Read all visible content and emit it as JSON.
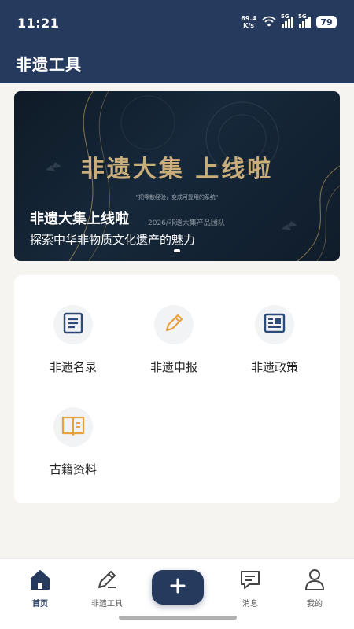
{
  "status_bar": {
    "time": "11:21",
    "net_speed_value": "69.4",
    "net_speed_unit": "K/s",
    "sim1_label": "5G",
    "sim2_label": "5G",
    "battery": "79"
  },
  "header": {
    "title": "非遗工具"
  },
  "banner": {
    "headline": "非遗大集 上线啦",
    "tagline": "\"把零散经验，变成可复用的系统\"",
    "team": "2026/非遗大集产品团队",
    "title": "非遗大集上线啦",
    "description": "探索中华非物质文化遗产的魅力",
    "carousel_total": 1,
    "carousel_active": 1
  },
  "tools": [
    {
      "label": "非遗名录",
      "icon": "document-list-icon",
      "color": "#2c4a7a"
    },
    {
      "label": "非遗申报",
      "icon": "pencil-icon",
      "color": "#e8a23c"
    },
    {
      "label": "非遗政策",
      "icon": "policy-newspaper-icon",
      "color": "#2c4a7a"
    },
    {
      "label": "古籍资料",
      "icon": "open-book-icon",
      "color": "#e8a23c"
    }
  ],
  "bottom_nav": {
    "items": [
      {
        "label": "首页",
        "icon": "home-icon",
        "active": true
      },
      {
        "label": "非遗工具",
        "icon": "pencil-icon",
        "active": false
      },
      {
        "label": "消息",
        "icon": "message-icon",
        "active": false
      },
      {
        "label": "我的",
        "icon": "user-icon",
        "active": false
      }
    ],
    "add_button_icon": "plus-icon"
  },
  "colors": {
    "primary": "#263a5e",
    "accent": "#e8a23c",
    "banner_gold": "#c9ad7a",
    "background": "#f5f4f1"
  }
}
